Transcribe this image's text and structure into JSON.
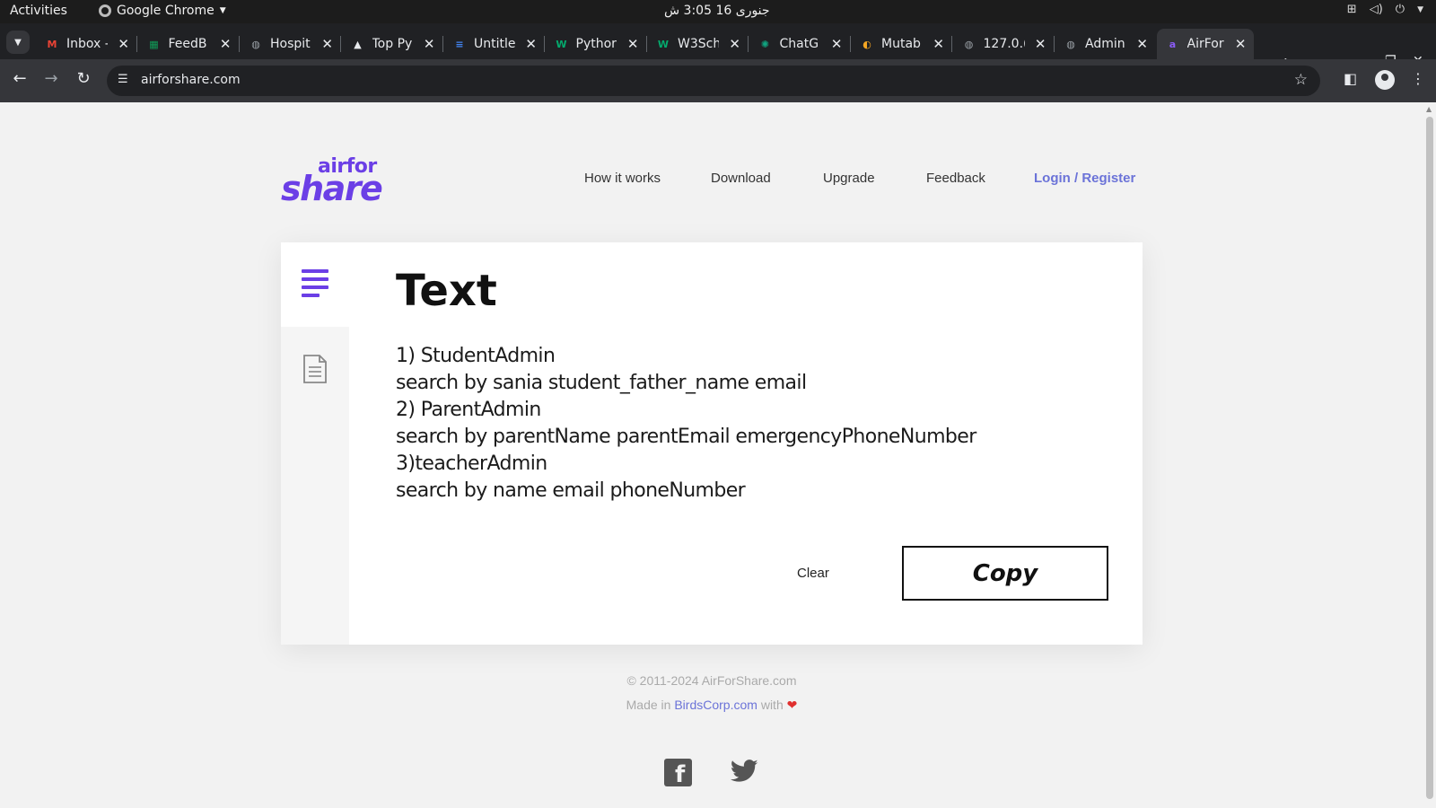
{
  "system": {
    "activities": "Activities",
    "app_name": "Google Chrome",
    "clock": "جنوری 16  3:05 ش"
  },
  "tabs": [
    {
      "title": "Inbox -",
      "favicon": "gmail-icon",
      "color": "#ea4335"
    },
    {
      "title": "FeedB",
      "favicon": "sheets-icon",
      "color": "#0f9d58"
    },
    {
      "title": "Hospit",
      "favicon": "globe-icon",
      "color": "#9aa0a6"
    },
    {
      "title": "Top Py",
      "favicon": "mountain-icon",
      "color": "#e8eaed"
    },
    {
      "title": "Untitle",
      "favicon": "docs-icon",
      "color": "#4285f4"
    },
    {
      "title": "Pythor",
      "favicon": "w3-icon",
      "color": "#04aa6d"
    },
    {
      "title": "W3Sch",
      "favicon": "w3-icon",
      "color": "#04aa6d"
    },
    {
      "title": "ChatG",
      "favicon": "chatgpt-icon",
      "color": "#10a37f"
    },
    {
      "title": "Mutab",
      "favicon": "mutab-icon",
      "color": "#f5a623"
    },
    {
      "title": "127.0.(",
      "favicon": "globe-icon",
      "color": "#9aa0a6"
    },
    {
      "title": "Admin",
      "favicon": "globe-icon",
      "color": "#9aa0a6"
    },
    {
      "title": "AirFor",
      "favicon": "airforshare-icon",
      "color": "#8b5cf6",
      "active": true
    }
  ],
  "address_bar": {
    "url": "airforshare.com"
  },
  "site": {
    "logo_top": "airfor",
    "logo_bottom": "share",
    "nav": {
      "how": "How it works",
      "download": "Download",
      "upgrade": "Upgrade",
      "feedback": "Feedback",
      "login": "Login / Register"
    },
    "heading": "Text",
    "lines": [
      "1) StudentAdmin",
      "search by sania student_father_name email",
      "2) ParentAdmin",
      "search by parentName parentEmail emergencyPhoneNumber",
      "3)teacherAdmin",
      "search by name email phoneNumber"
    ],
    "clear_label": "Clear",
    "copy_label": "Copy",
    "footer": {
      "copyright": "© 2011-2024 AirForShare.com",
      "made_in": "Made in ",
      "company": "BirdsCorp.com",
      "with": " with ",
      "heart": "❤"
    }
  }
}
